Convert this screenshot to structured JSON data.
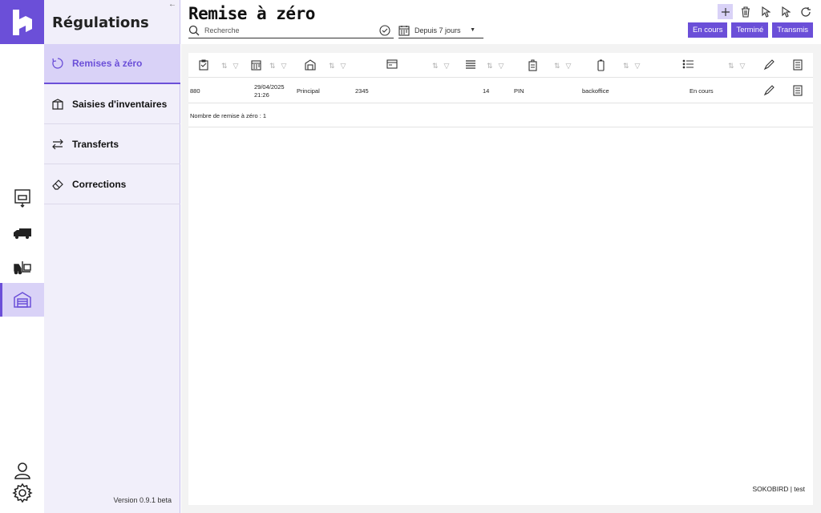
{
  "rail": {
    "icons": [
      "box-icon",
      "truck-icon",
      "forklift-icon",
      "warehouse-icon"
    ],
    "bottom": [
      "user-icon",
      "gear-icon"
    ]
  },
  "sidebar": {
    "title": "Régulations",
    "collapse_icon": "←",
    "items": [
      {
        "label": "Remises à zéro",
        "icon": "reset-icon",
        "active": true
      },
      {
        "label": "Saisies d'inventaires",
        "icon": "inventory-box-icon",
        "active": false
      },
      {
        "label": "Transferts",
        "icon": "transfer-icon",
        "active": false
      },
      {
        "label": "Corrections",
        "icon": "eraser-icon",
        "active": false
      }
    ],
    "version": "Version 0.9.1 beta"
  },
  "header": {
    "title": "Remise à zéro",
    "search_placeholder": "Recherche",
    "date_filter": "Depuis 7 jours",
    "toolbar": [
      "plus-icon",
      "trash-icon",
      "cursor-icon",
      "cursor-outline-icon",
      "refresh-icon"
    ],
    "status_buttons": [
      "En cours",
      "Terminé",
      "Transmis"
    ]
  },
  "table": {
    "columns": [
      "checklist-icon",
      "calendar-icon",
      "warehouse-icon",
      "card-icon",
      "list-icon",
      "badge-icon",
      "phone-icon",
      "bullet-list-icon",
      "pen-icon",
      "document-icon"
    ],
    "rows": [
      {
        "id": "880",
        "date": "29/04/2025",
        "time": "21:26",
        "warehouse": "Principal",
        "card": "2345",
        "count": "14",
        "badge": "PIN",
        "source": "backoffice",
        "status": "En cours"
      }
    ],
    "summary": "Nombre de remise à zéro : 1"
  },
  "footer": {
    "user": "SOKOBIRD | test"
  },
  "colors": {
    "accent": "#6b4fd8",
    "accent_light": "#d9d2f7",
    "sidebar_bg": "#f1effa"
  }
}
